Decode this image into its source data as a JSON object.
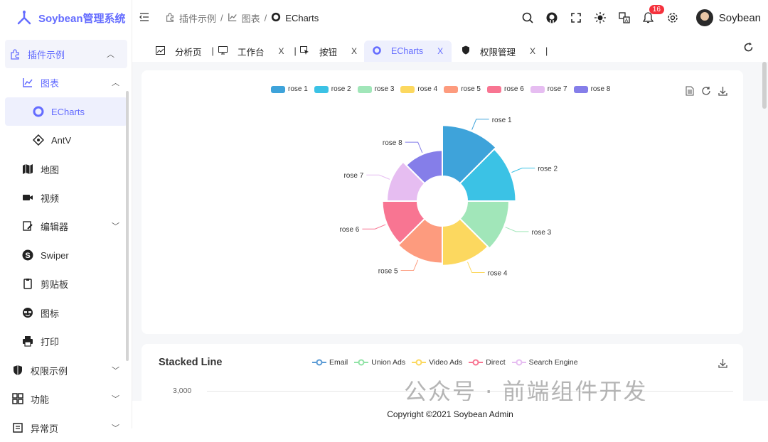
{
  "app": {
    "title": "Soybean管理系统"
  },
  "sidebar": {
    "items": [
      {
        "label": "插件示例",
        "icon": "plugin-icon"
      },
      {
        "label": "图表",
        "icon": "chart-icon"
      },
      {
        "label": "ECharts",
        "icon": "echarts-icon"
      },
      {
        "label": "AntV",
        "icon": "antv-icon"
      },
      {
        "label": "地图",
        "icon": "map-icon"
      },
      {
        "label": "视频",
        "icon": "video-icon"
      },
      {
        "label": "编辑器",
        "icon": "editor-icon"
      },
      {
        "label": "Swiper",
        "icon": "swiper-icon"
      },
      {
        "label": "剪贴板",
        "icon": "clipboard-icon"
      },
      {
        "label": "图标",
        "icon": "face-icon"
      },
      {
        "label": "打印",
        "icon": "printer-icon"
      },
      {
        "label": "权限示例",
        "icon": "shield-icon"
      },
      {
        "label": "功能",
        "icon": "grid-icon"
      },
      {
        "label": "异常页",
        "icon": "file-icon"
      }
    ]
  },
  "header": {
    "breadcrumb": [
      "插件示例",
      "图表",
      "ECharts"
    ],
    "notification_count": "16",
    "username": "Soybean"
  },
  "tabs": [
    {
      "label": "分析页"
    },
    {
      "label": "工作台"
    },
    {
      "label": "按钮"
    },
    {
      "label": "ECharts"
    },
    {
      "label": "权限管理"
    }
  ],
  "rose_chart": {
    "type": "pie",
    "series": [
      "rose 1",
      "rose 2",
      "rose 3",
      "rose 4",
      "rose 5",
      "rose 6",
      "rose 7",
      "rose 8"
    ],
    "colors": [
      "#3ea3da",
      "#3bc2e5",
      "#a1e6b9",
      "#fcd85f",
      "#fd9b7e",
      "#f87592",
      "#e6bdf1",
      "#857ee9"
    ]
  },
  "chart_data": [
    {
      "type": "pie",
      "categories": [
        "rose 1",
        "rose 2",
        "rose 3",
        "rose 4",
        "rose 5",
        "rose 6",
        "rose 7",
        "rose 8"
      ],
      "values": [
        40,
        38,
        32,
        30,
        28,
        26,
        22,
        18
      ]
    },
    {
      "type": "line",
      "title": "Stacked Line",
      "series": [
        {
          "name": "Email"
        },
        {
          "name": "Union Ads"
        },
        {
          "name": "Video Ads"
        },
        {
          "name": "Direct"
        },
        {
          "name": "Search Engine"
        }
      ],
      "colors": [
        "#5b9bd5",
        "#91e3a6",
        "#fcd85f",
        "#f87592",
        "#e6bdf1"
      ],
      "yticks": [
        "3,000"
      ]
    }
  ],
  "footer": {
    "copyright": "Copyright ©2021 Soybean Admin"
  },
  "watermark": {
    "text": "公众号 · 前端组件开发"
  }
}
